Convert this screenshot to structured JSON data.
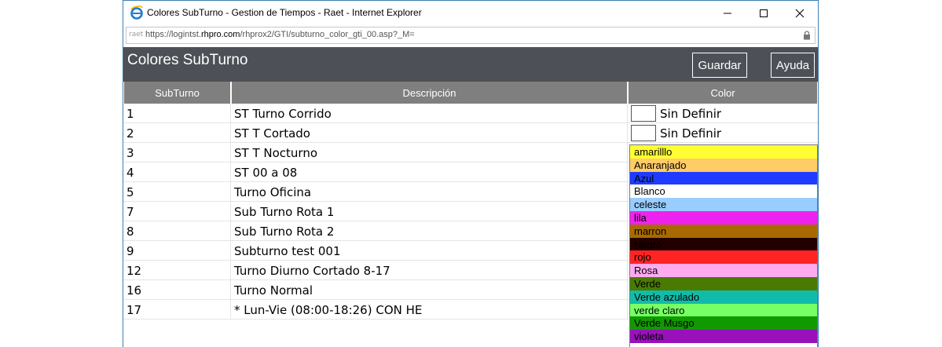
{
  "window": {
    "title": "Colores SubTurno - Gestion de Tiempos - Raet - Internet Explorer",
    "minimize_icon": "minimize-icon",
    "maximize_icon": "maximize-icon",
    "close_icon": "close-icon"
  },
  "address": {
    "prefix": "raet",
    "url_scheme": "https://logintst.",
    "url_domain": "rhpro.com",
    "url_path": "/rhprox2/GTI/subturno_color_gti_00.asp?_M="
  },
  "header": {
    "title": "Colores SubTurno",
    "save_label": "Guardar",
    "help_label": "Ayuda"
  },
  "table": {
    "columns": [
      "SubTurno",
      "Descripción",
      "Color"
    ],
    "rows": [
      {
        "id": "1",
        "desc": "ST Turno Corrido",
        "color": "Sin Definir"
      },
      {
        "id": "2",
        "desc": "ST T Cortado",
        "color": "Sin Definir"
      },
      {
        "id": "3",
        "desc": "ST T Nocturno",
        "color": ""
      },
      {
        "id": "4",
        "desc": "ST 00 a 08",
        "color": ""
      },
      {
        "id": "5",
        "desc": "Turno Oficina",
        "color": ""
      },
      {
        "id": "7",
        "desc": "Sub Turno Rota 1",
        "color": ""
      },
      {
        "id": "8",
        "desc": "Sub Turno Rota 2",
        "color": ""
      },
      {
        "id": "9",
        "desc": "Subturno test 001",
        "color": ""
      },
      {
        "id": "12",
        "desc": "Turno Diurno Cortado 8-17",
        "color": ""
      },
      {
        "id": "16",
        "desc": "Turno Normal",
        "color": ""
      },
      {
        "id": "17",
        "desc": "* Lun-Vie (08:00-18:26) CON HE",
        "color": ""
      }
    ]
  },
  "dropdown": {
    "options": [
      {
        "label": "amarilllo",
        "bg": "#ffff33",
        "fg": "#000000"
      },
      {
        "label": "Anaranjado",
        "bg": "#ffcc66",
        "fg": "#000000"
      },
      {
        "label": "Azul",
        "bg": "#1f3bff",
        "fg": "#000000"
      },
      {
        "label": "Blanco",
        "bg": "#ffffff",
        "fg": "#000000"
      },
      {
        "label": "celeste",
        "bg": "#99ccff",
        "fg": "#000000"
      },
      {
        "label": "lila",
        "bg": "#ee22ee",
        "fg": "#000000"
      },
      {
        "label": "marron",
        "bg": "#a86a00",
        "fg": "#000000"
      },
      {
        "label": "Negro",
        "bg": "#220000",
        "fg": "#000000"
      },
      {
        "label": "rojo",
        "bg": "#ff2424",
        "fg": "#000000"
      },
      {
        "label": "Rosa",
        "bg": "#ffaaee",
        "fg": "#000000"
      },
      {
        "label": "Verde",
        "bg": "#4a7a00",
        "fg": "#000000"
      },
      {
        "label": "Verde azulado",
        "bg": "#11bbaa",
        "fg": "#000000"
      },
      {
        "label": "verde claro",
        "bg": "#77ff66",
        "fg": "#000000"
      },
      {
        "label": "Verde Musgo",
        "bg": "#119900",
        "fg": "#000000"
      },
      {
        "label": "violeta",
        "bg": "#9911bb",
        "fg": "#000000"
      }
    ]
  }
}
